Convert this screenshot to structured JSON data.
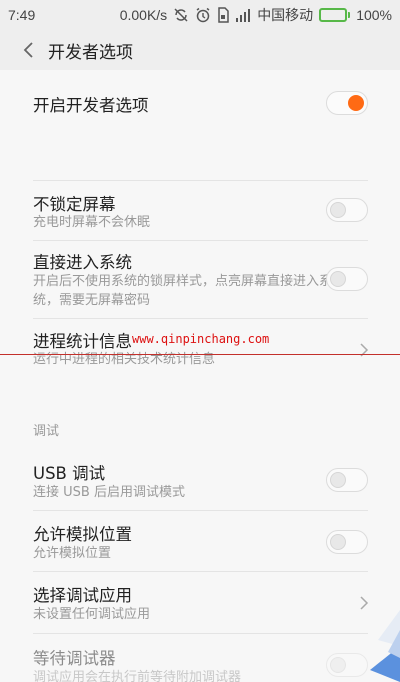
{
  "status_bar": {
    "time": "7:49",
    "net_speed": "0.00K/s",
    "carrier": "中国移动",
    "battery": "100%",
    "battery_level": 1.0,
    "accent_color": "#57b848"
  },
  "header": {
    "title": "开发者选项",
    "back_icon": "chevron-left-icon"
  },
  "settings": {
    "developer_options": {
      "title": "开启开发者选项",
      "enabled": true
    },
    "stay_awake": {
      "title": "不锁定屏幕",
      "subtitle": "充电时屏幕不会休眠",
      "enabled": false
    },
    "direct_boot": {
      "title": "直接进入系统",
      "subtitle": "开启后不使用系统的锁屏样式，点亮屏幕直接进入系统，需要无屏幕密码",
      "enabled": false
    },
    "process_stats": {
      "title": "进程统计信息",
      "subtitle": "运行中进程的相关技术统计信息"
    },
    "debug_section": "调试",
    "usb_debugging": {
      "title": "USB 调试",
      "subtitle": "连接 USB 后启用调试模式",
      "enabled": false
    },
    "mock_location": {
      "title": "允许模拟位置",
      "subtitle": "允许模拟位置",
      "enabled": false
    },
    "select_debug_app": {
      "title": "选择调试应用",
      "subtitle": "未设置任何调试应用"
    },
    "wait_debugger": {
      "title": "等待调试器",
      "subtitle": "调试应用会在执行前等待附加调试器",
      "enabled": false
    }
  },
  "watermark": "www.qinpinchang.com",
  "toggle_on_color": "#ff6a14"
}
